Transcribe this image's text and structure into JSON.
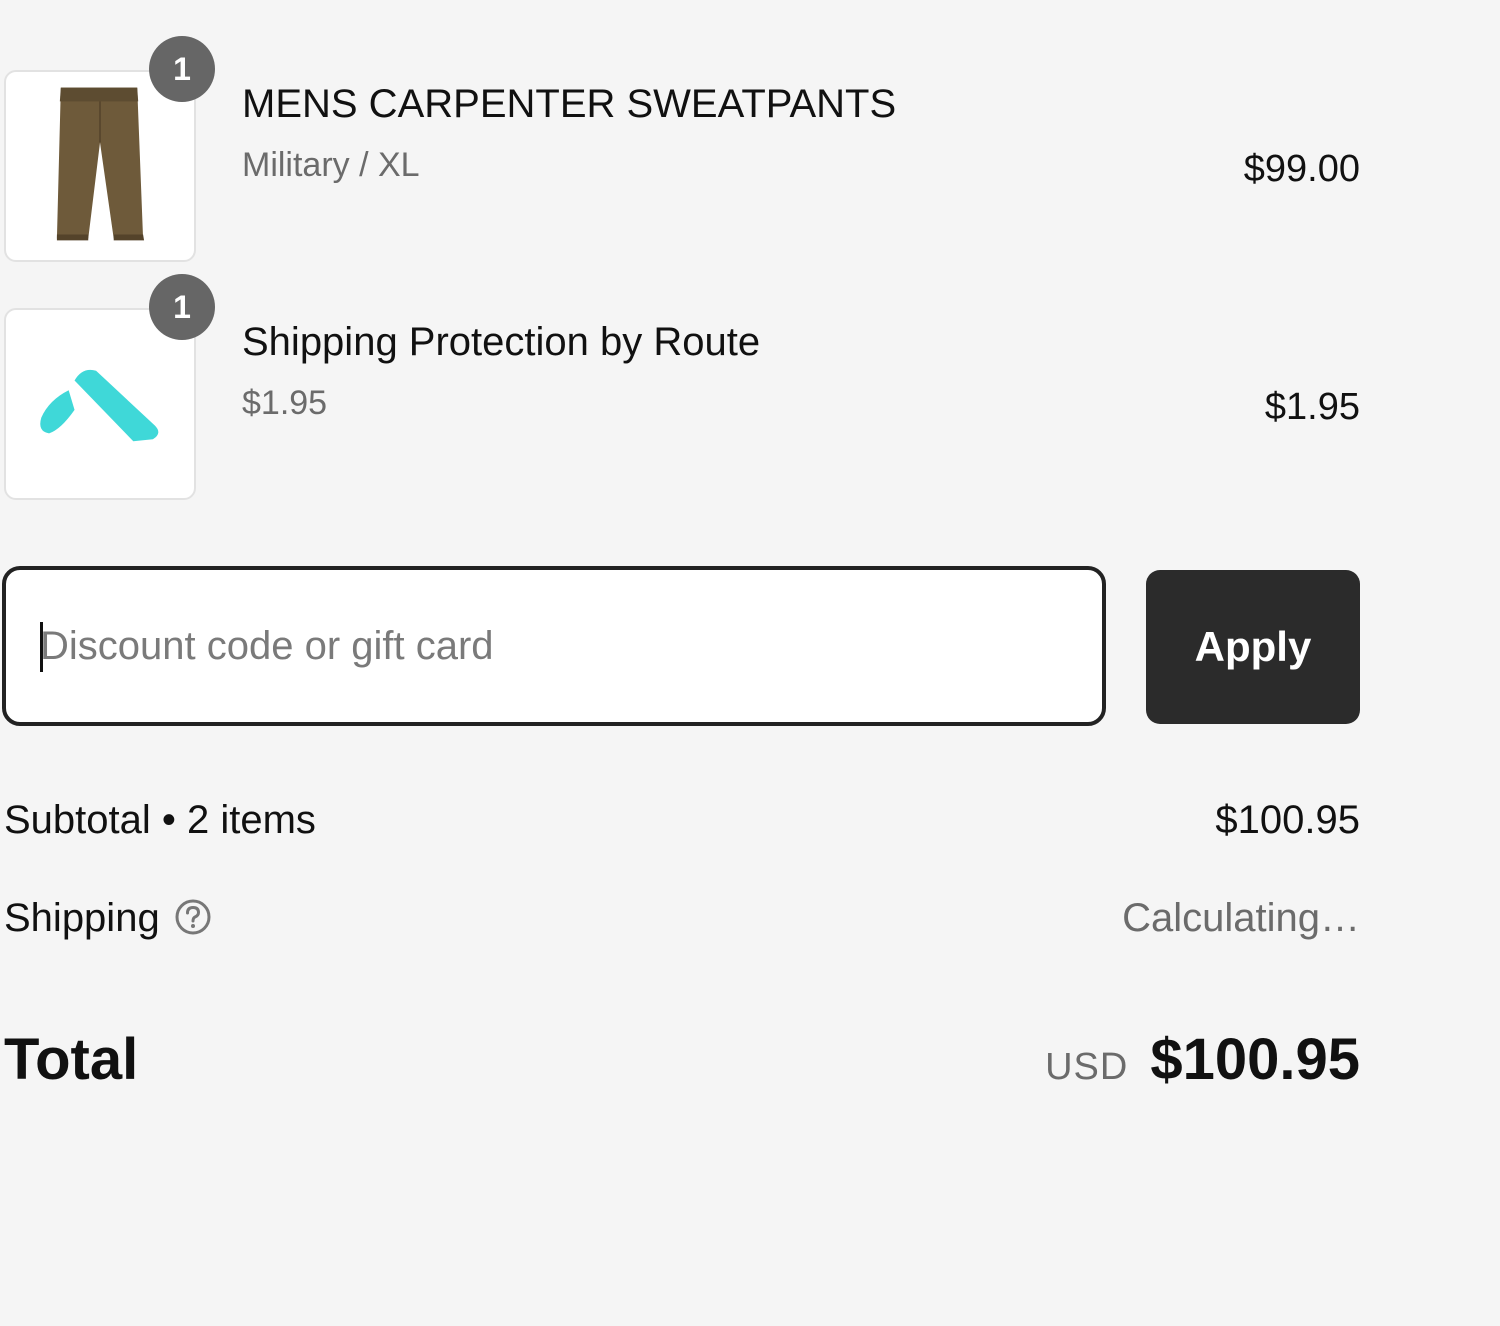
{
  "colors": {
    "background": "#f5f5f5",
    "badge": "#666666",
    "apply_button": "#2b2b2b",
    "route_logo": "#3fd8d8",
    "pants": "#6e5a3a"
  },
  "line_items": [
    {
      "quantity": "1",
      "name": "MENS CARPENTER SWEATPANTS",
      "variant": "Military / XL",
      "price": "$99.00",
      "thumbnail_icon": "pants-icon"
    },
    {
      "quantity": "1",
      "name": "Shipping Protection by Route",
      "variant": "$1.95",
      "price": "$1.95",
      "thumbnail_icon": "route-logo-icon"
    }
  ],
  "discount": {
    "placeholder": "Discount code or gift card",
    "value": "",
    "apply_label": "Apply"
  },
  "summary": {
    "subtotal_label": "Subtotal • 2 items",
    "subtotal_value": "$100.95",
    "shipping_label": "Shipping",
    "shipping_help_icon": "question-circle-icon",
    "shipping_value": "Calculating…",
    "total_label": "Total",
    "currency": "USD",
    "total_value": "$100.95"
  }
}
